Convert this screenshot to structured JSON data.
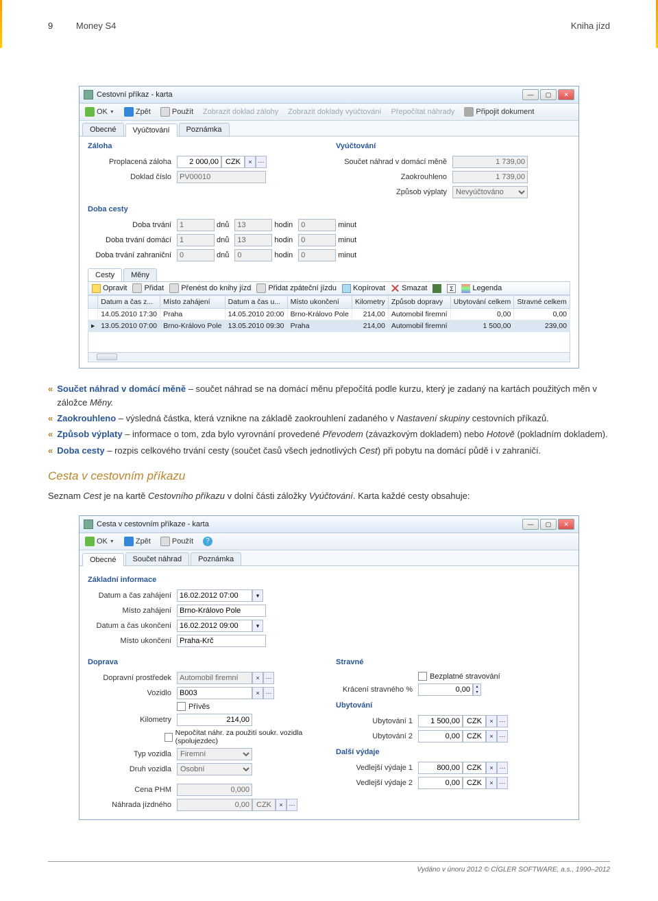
{
  "page": {
    "number": "9",
    "title_left": "Money S4",
    "title_right": "Kniha jízd"
  },
  "win1": {
    "title": "Cestovní příkaz - karta",
    "toolbar": {
      "ok": "OK",
      "back": "Zpět",
      "use": "Použít",
      "show_advance": "Zobrazit doklad zálohy",
      "show_billing": "Zobrazit doklady vyúčtování",
      "recalc": "Přepočítat náhrady",
      "attach": "Připojit dokument"
    },
    "tabs": [
      "Obecné",
      "Vyúčtování",
      "Poznámka"
    ],
    "active_tab": 1,
    "zaloha": {
      "title": "Záloha",
      "l_paid": "Proplacená záloha",
      "v_paid": "2 000,00",
      "currency": "CZK",
      "l_doc": "Doklad číslo",
      "v_doc": "PV00010"
    },
    "billing": {
      "title": "Vyúčtování",
      "l_sum": "Součet náhrad v domácí měně",
      "v_sum": "1 739,00",
      "l_round": "Zaokrouhleno",
      "v_round": "1 739,00",
      "l_method": "Způsob výplaty",
      "v_method": "Nevyúčtováno"
    },
    "duration": {
      "title": "Doba cesty",
      "l_total": "Doba trvání",
      "l_home": "Doba trvání domácí",
      "l_abroad": "Doba trvání zahraniční",
      "u_days": "dnů",
      "u_hours": "hodin",
      "u_min": "minut",
      "rows": [
        {
          "d": "1",
          "h": "13",
          "m": "0"
        },
        {
          "d": "1",
          "h": "13",
          "m": "0"
        },
        {
          "d": "0",
          "h": "0",
          "m": "0"
        }
      ]
    },
    "subtabs": [
      "Cesty",
      "Měny"
    ],
    "grid_toolbar": {
      "edit": "Opravit",
      "add": "Přidat",
      "transfer": "Přenést do knihy jízd",
      "return_trip": "Přidat zpáteční jízdu",
      "copy": "Kopírovat",
      "delete": "Smazat",
      "legend": "Legenda"
    },
    "grid_cols": [
      "Datum a čas z...",
      "Místo zahájení",
      "Datum a čas u...",
      "Místo ukončení",
      "Kilometry",
      "Způsob dopravy",
      "Ubytování celkem",
      "Stravné celkem"
    ],
    "grid_rows": [
      [
        "14.05.2010 17:30",
        "Praha",
        "14.05.2010 20:00",
        "Brno-Královo Pole",
        "214,00",
        "Automobil firemní",
        "0,00",
        "0,00"
      ],
      [
        "13.05.2010 07:00",
        "Brno-Královo Pole",
        "13.05.2010 09:30",
        "Praha",
        "214,00",
        "Automobil firemní",
        "1 500,00",
        "239,00"
      ]
    ]
  },
  "text": {
    "b1_term": "Součet náhrad v domácí měně",
    "b1_rest": " – součet náhrad se na domácí měnu přepočítá podle kurzu, který je zadaný na kartách použitých měn v záložce ",
    "b1_ital": "Měny.",
    "b2_term": "Zaokrouhleno",
    "b2_rest": " – výsledná částka, která vznikne na základě zaokrouhlení zadaného v ",
    "b2_ital": "Nastavení skupiny",
    "b2_rest2": " cestovních příkazů.",
    "b3_term": "Způsob výplaty",
    "b3_rest": " – informace o tom, zda bylo vyrovnání provedené ",
    "b3_ital1": "Převodem",
    "b3_mid": " (závazkovým dokladem) nebo ",
    "b3_ital2": "Hotově",
    "b3_rest2": " (pokladním dokladem).",
    "b4_term": "Doba cesty",
    "b4_rest": " – rozpis celkového trvání cesty (součet časů všech jednotlivých ",
    "b4_ital": "Cest",
    "b4_rest2": ") při pobytu na domácí půdě i v zahraničí.",
    "heading": "Cesta v cestovním příkazu",
    "para1a": "Seznam ",
    "para1i1": "Cest",
    "para1b": " je na kartě ",
    "para1i2": "Cestovního příkazu",
    "para1c": " v dolní části záložky ",
    "para1i3": "Vyúčtování",
    "para1d": ". Karta každé cesty obsahuje:"
  },
  "win2": {
    "title": "Cesta v cestovním příkaze - karta",
    "toolbar": {
      "ok": "OK",
      "back": "Zpět",
      "use": "Použít"
    },
    "tabs": [
      "Obecné",
      "Součet náhrad",
      "Poznámka"
    ],
    "basic": {
      "title": "Základní informace",
      "l_start_dt": "Datum a čas zahájení",
      "v_start_dt": "16.02.2012 07:00",
      "l_start_pl": "Místo zahájení",
      "v_start_pl": "Brno-Královo Pole",
      "l_end_dt": "Datum a čas ukončení",
      "v_end_dt": "16.02.2012 09:00",
      "l_end_pl": "Místo ukončení",
      "v_end_pl": "Praha-Krč"
    },
    "transport": {
      "title": "Doprava",
      "l_means": "Dopravní prostředek",
      "v_means": "Automobil firemní",
      "l_vehicle": "Vozidlo",
      "v_vehicle": "B003",
      "l_trailer": "Přívěs",
      "l_km": "Kilometry",
      "v_km": "214,00",
      "l_nocalc": "Nepočítat náhr. za použití soukr. vozidla (spolujezdec)",
      "l_vtype": "Typ vozidla",
      "v_vtype": "Firemní",
      "l_vkind": "Druh vozidla",
      "v_vkind": "Osobní",
      "l_fuel": "Cena PHM",
      "v_fuel": "0,000",
      "l_refund": "Náhrada jízdného",
      "v_refund": "0,00",
      "v_refund_cur": "CZK"
    },
    "meals": {
      "title": "Stravné",
      "l_free": "Bezplatné stravování",
      "l_reduce": "Krácení stravného %",
      "v_reduce": "0,00"
    },
    "accom": {
      "title": "Ubytování",
      "l_a1": "Ubytování 1",
      "v_a1": "1 500,00",
      "c_a1": "CZK",
      "l_a2": "Ubytování 2",
      "v_a2": "0,00",
      "c_a2": "CZK"
    },
    "other": {
      "title": "Další výdaje",
      "l_e1": "Vedlejší výdaje 1",
      "v_e1": "800,00",
      "c_e1": "CZK",
      "l_e2": "Vedlejší výdaje 2",
      "v_e2": "0,00",
      "c_e2": "CZK"
    }
  },
  "footer": "Vydáno v únoru 2012 © CÍGLER SOFTWARE, a.s., 1990–2012"
}
